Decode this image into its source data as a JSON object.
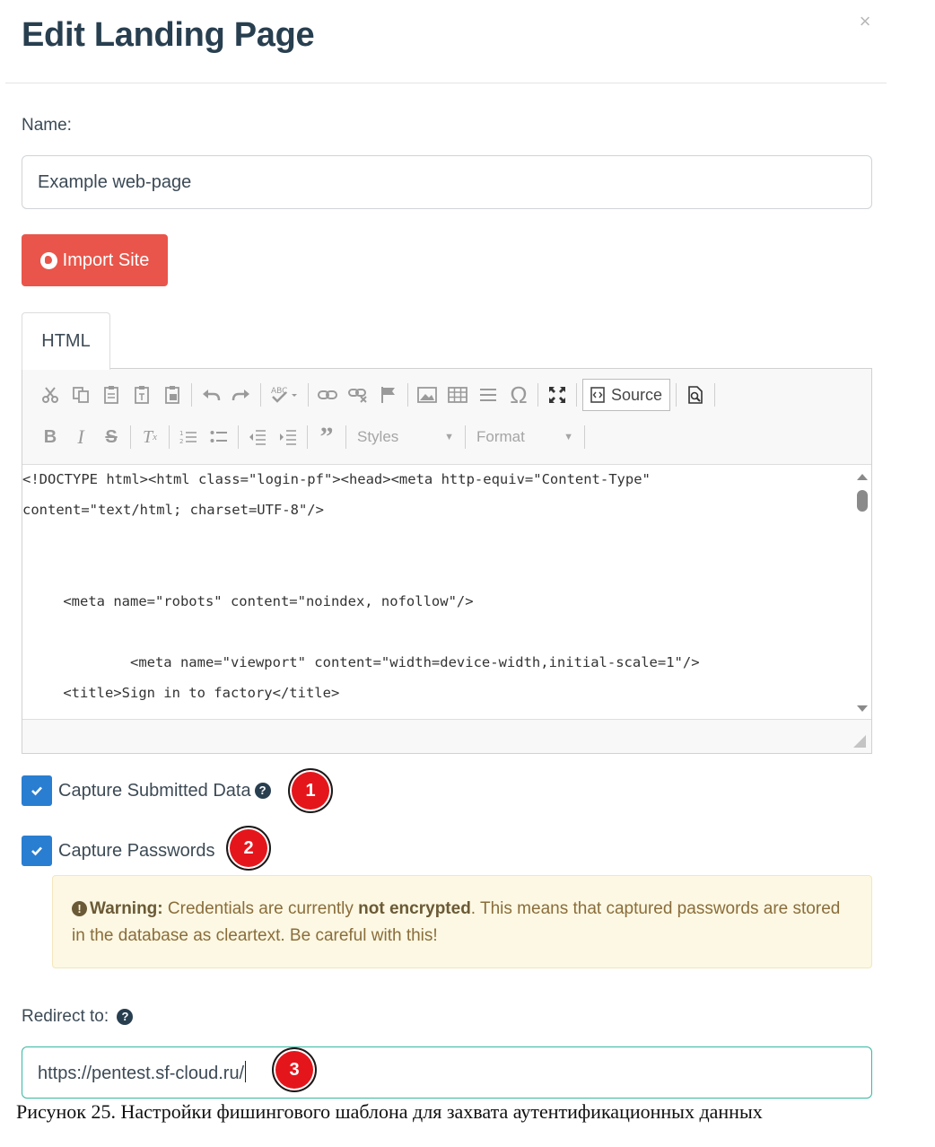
{
  "dialog": {
    "title": "Edit Landing Page",
    "close_glyph": "×"
  },
  "name_field": {
    "label": "Name:",
    "value": "Example web-page"
  },
  "import_button": {
    "label": "Import Site",
    "icon": "globe-icon"
  },
  "editor": {
    "tab_label": "HTML",
    "toolbar_row1": [
      "cut",
      "copy",
      "paste",
      "paste-text",
      "paste-from-word",
      "undo",
      "redo",
      "spellcheck",
      "link",
      "unlink",
      "anchor",
      "image",
      "table",
      "horizontal-line",
      "special-char",
      "maximize",
      "source",
      "preview"
    ],
    "toolbar_row2": [
      "bold",
      "italic",
      "strike",
      "remove-format",
      "numbered-list",
      "bulleted-list",
      "outdent",
      "indent",
      "blockquote",
      "styles",
      "format"
    ],
    "source_label": "Source",
    "styles_label": "Styles",
    "format_label": "Format",
    "code_lines": [
      "<!DOCTYPE html><html class=\"login-pf\"><head><meta http-equiv=\"Content-Type\"",
      "content=\"text/html; charset=UTF-8\"/>",
      "    <meta name=\"robots\" content=\"noindex, nofollow\"/>",
      "            <meta name=\"viewport\" content=\"width=device-width,initial-scale=1\"/>",
      "    <title>Sign in to factory</title>"
    ]
  },
  "options": {
    "capture_submitted": {
      "label": "Capture Submitted Data",
      "checked": true,
      "badge": "1"
    },
    "capture_passwords": {
      "label": "Capture Passwords",
      "checked": true,
      "badge": "2"
    }
  },
  "warning": {
    "prefix": "Warning:",
    "text_before": " Credentials are currently ",
    "emphasis": "not encrypted",
    "text_after": ". This means that captured passwords are stored in the database as cleartext. Be careful with this!"
  },
  "redirect": {
    "label": "Redirect to:",
    "value": "https://pentest.sf-cloud.ru/",
    "badge": "3"
  },
  "caption": "Рисунок 25. Настройки фишингового шаблона для захвата аутентификационных данных",
  "colors": {
    "primary": "#2a7ed1",
    "danger": "#e9554a",
    "badge": "#e4161c",
    "warning_bg": "#fcf8e3",
    "focus": "#36b9a0"
  }
}
